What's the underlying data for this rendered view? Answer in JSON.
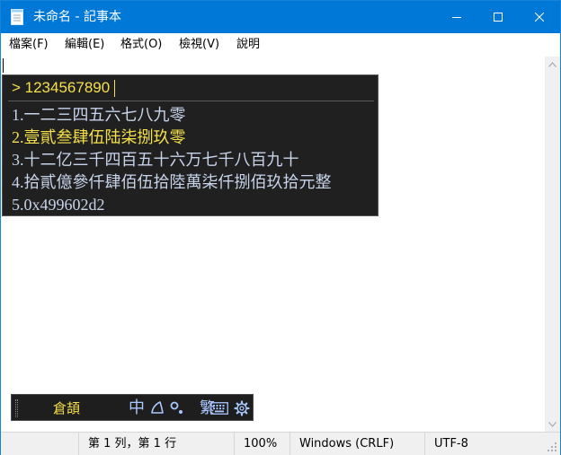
{
  "window": {
    "title": "未命名 - 記事本",
    "accent_color": "#0078d7",
    "icons": {
      "app": "notepad-icon",
      "minimize": "minimize-icon",
      "maximize": "maximize-icon",
      "close": "close-icon"
    }
  },
  "menu": {
    "items": [
      {
        "label": "檔案(F)"
      },
      {
        "label": "編輯(E)"
      },
      {
        "label": "格式(O)"
      },
      {
        "label": "檢視(V)"
      },
      {
        "label": "說明"
      }
    ]
  },
  "ime": {
    "input": "> 1234567890",
    "text_color": "#f5e04a",
    "candidate_color": "#c7d4ea",
    "candidates": [
      {
        "label": "1.一二三四五六七八九零"
      },
      {
        "label": "2.壹貳叁肆伍陆柒捌玖零"
      },
      {
        "label": "3.十二亿三千四百五十六万七千八百九十"
      },
      {
        "label": "4.拾貳億參仟肆佰伍拾陸萬柒仟捌佰玖拾元整"
      },
      {
        "label": "5.0x499602d2"
      }
    ],
    "selected_index": 1
  },
  "ime_toolbar": {
    "name": "倉頡",
    "mode": "中",
    "trad": "繁",
    "icons": [
      "half-moon-icon",
      "punctuation-icon",
      "keyboard-icon",
      "gear-icon"
    ]
  },
  "status": {
    "position": "第 1 列，第 1 行",
    "zoom": "100%",
    "line_ending": "Windows (CRLF)",
    "encoding": "UTF-8"
  }
}
